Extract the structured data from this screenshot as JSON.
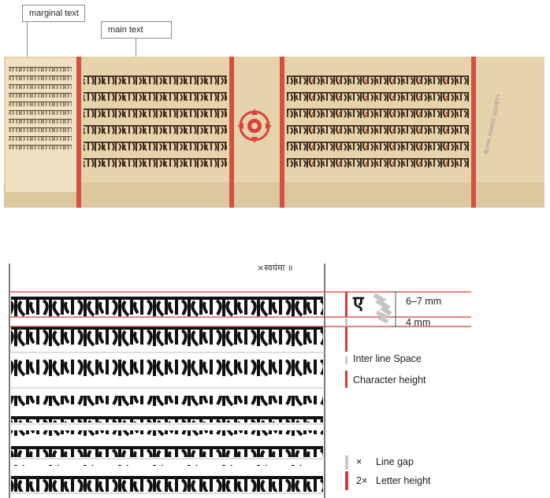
{
  "callouts": {
    "marginal": "marginal text",
    "main": "main text"
  },
  "manuscript": {
    "colors": {
      "paper": "#e6d3ab",
      "paper_dark": "#c9b289",
      "rule_red": "#d4503f",
      "ink": "#3a2a1c",
      "ink_red": "#b35733",
      "medallion": "#d8433a"
    },
    "stamp": "ROYAL ASIATIC SOCIETY"
  },
  "measurements": {
    "line_height": "6–7 mm",
    "line_gap": "4 mm"
  },
  "legend": {
    "inter_line_space": "Inter line Space",
    "character_height": "Character height",
    "line_gap_symbol": "×",
    "line_gap": "Line gap",
    "letter_height_prefix": "2×",
    "letter_height": "Letter height"
  },
  "colors": {
    "guide_red": "#d63a3a",
    "gray_bar": "#c8c8c8",
    "red_bar": "#d63a3a"
  },
  "detail": {
    "sample_glyph": "ए",
    "top_note": "×स्वयंमा ॥"
  }
}
